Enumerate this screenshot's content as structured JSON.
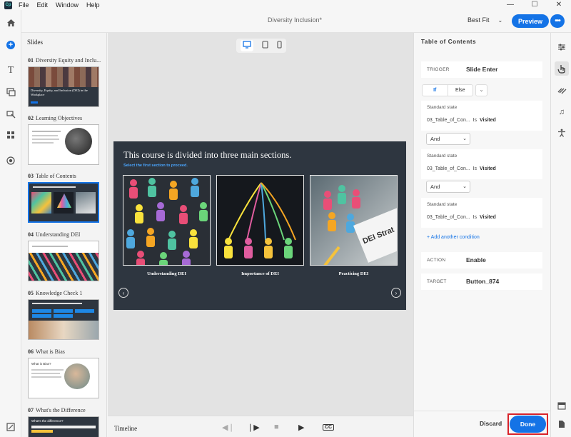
{
  "app": {
    "logo": "Cp",
    "menu": [
      "File",
      "Edit",
      "Window",
      "Help"
    ],
    "document_title": "Diversity Inclusion*",
    "zoom": "Best Fit",
    "preview_label": "Preview",
    "more_label": "•••"
  },
  "window": {
    "minimize": "—",
    "maximize": "☐",
    "close": "✕"
  },
  "slides_panel": {
    "heading": "Slides",
    "slides": [
      {
        "num": "01",
        "title": "Diversity Equity and Inclu...",
        "thumb_text": "Diversity, Equity, and Inclusion (DEI) in the Workplace"
      },
      {
        "num": "02",
        "title": "Learning Objectives",
        "thumb_text": ""
      },
      {
        "num": "03",
        "title": "Table of Contents",
        "thumb_text": ""
      },
      {
        "num": "04",
        "title": "Understanding DEI",
        "thumb_text": ""
      },
      {
        "num": "05",
        "title": "Knowledge Check 1",
        "thumb_text": ""
      },
      {
        "num": "06",
        "title": "What is Bias",
        "thumb_text": "What is Bias?"
      },
      {
        "num": "07",
        "title": "What's the Difference",
        "thumb_text": "What's the difference?"
      }
    ]
  },
  "slide": {
    "title": "This course is divided into three main sections.",
    "subtitle": "Select the first section to proceed.",
    "cards": [
      "Understanding DEI",
      "Importance of DEI",
      "Practicing DEI"
    ],
    "card3_sign": "DEI Strat"
  },
  "timeline": {
    "label": "Timeline",
    "prev": "◀❘",
    "step": "❘▶",
    "stop": "■",
    "play": "▶",
    "cc": "CC"
  },
  "properties": {
    "title": "Table of Contents",
    "trigger_key": "TRIGGER",
    "trigger_value": "Slide Enter",
    "if_label": "If",
    "else_label": "Else",
    "conditions": [
      {
        "state": "Standard state",
        "object": "03_Table_of_Con...",
        "op": "Is",
        "value": "Visited"
      },
      {
        "state": "Standard state",
        "object": "03_Table_of_Con...",
        "op": "Is",
        "value": "Visited"
      },
      {
        "state": "Standard state",
        "object": "03_Table_of_Con...",
        "op": "Is",
        "value": "Visited"
      }
    ],
    "and_label": "And",
    "add_condition": "+ Add another condition",
    "action_key": "ACTION",
    "action_value": "Enable",
    "target_key": "TARGET",
    "target_value": "Button_874",
    "discard": "Discard",
    "done": "Done"
  },
  "colors": {
    "accent": "#1473e6",
    "slide_bg": "#2e3640",
    "highlight": "#d8232a"
  }
}
